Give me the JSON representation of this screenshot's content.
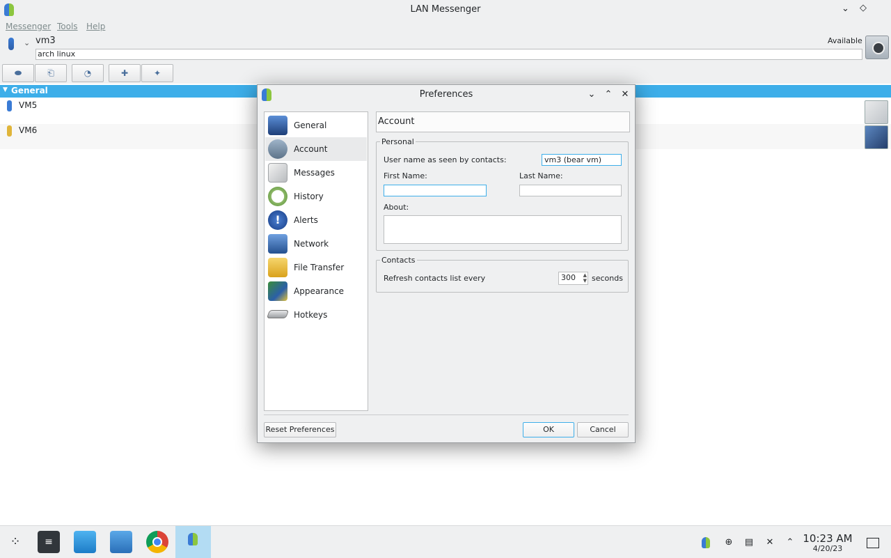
{
  "window": {
    "title": "LAN Messenger"
  },
  "menu": [
    "Messenger",
    "Tools",
    "Help"
  ],
  "user": {
    "name": "vm3",
    "status": "Available",
    "note": "arch linux"
  },
  "groups": [
    {
      "name": "General",
      "contacts": [
        "VM5",
        "VM6"
      ]
    }
  ],
  "dialog": {
    "title": "Preferences",
    "nav": [
      "General",
      "Account",
      "Messages",
      "History",
      "Alerts",
      "Network",
      "File Transfer",
      "Appearance",
      "Hotkeys"
    ],
    "selected": "Account",
    "header": "Account",
    "personal": {
      "legend": "Personal",
      "username_label": "User name as seen by contacts:",
      "username_value": "vm3 (bear vm)",
      "first_label": "First Name:",
      "first_value": "",
      "last_label": "Last Name:",
      "last_value": "",
      "about_label": "About:",
      "about_value": ""
    },
    "contacts": {
      "legend": "Contacts",
      "refresh_label": "Refresh contacts list every",
      "refresh_value": "300",
      "refresh_unit": "seconds"
    },
    "buttons": {
      "reset": "Reset Preferences",
      "ok": "OK",
      "cancel": "Cancel"
    }
  },
  "taskbar": {
    "time": "10:23 AM",
    "date": "4/20/23"
  },
  "colors": {
    "accent": "#3daee9",
    "window_bg": "#eff0f1",
    "panel_bg": "#ffffff"
  },
  "icons": [
    "app-icon",
    "webcam-icon",
    "minimize-icon",
    "maximize-icon",
    "close-icon"
  ]
}
